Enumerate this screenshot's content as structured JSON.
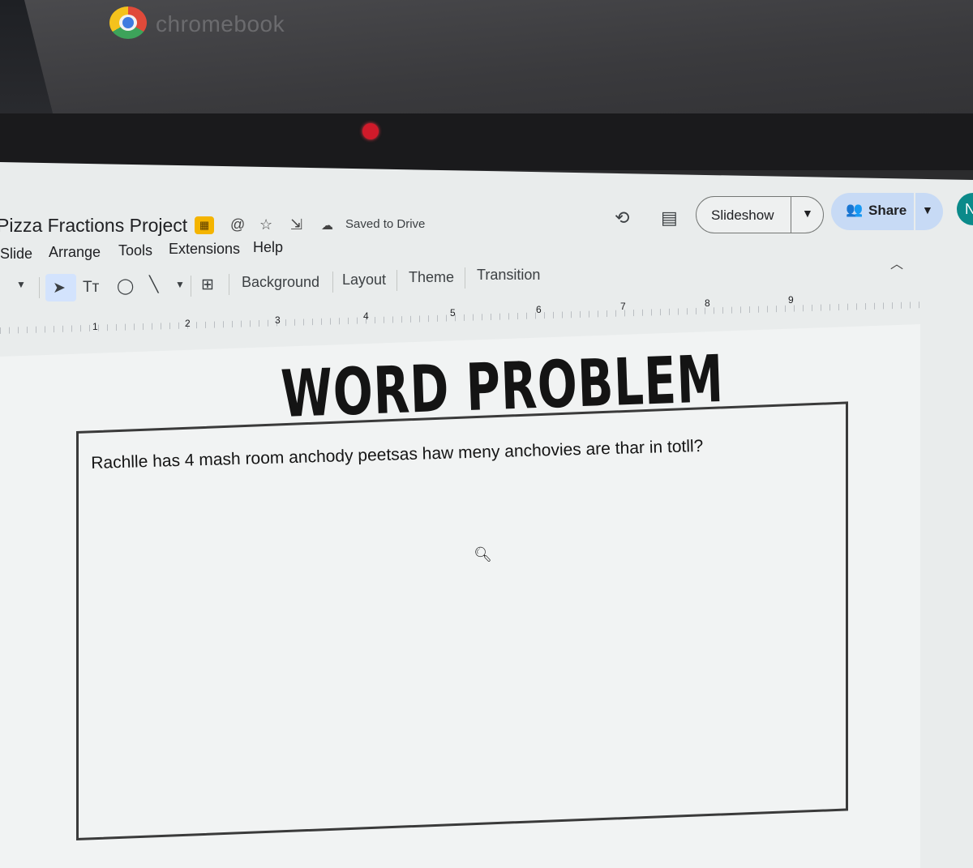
{
  "device": {
    "brand": "chromebook"
  },
  "doc": {
    "title": "Pizza Fractions Project",
    "saved_status": "Saved to Drive"
  },
  "menu": [
    "Slide",
    "Arrange",
    "Tools",
    "Extensions",
    "Help"
  ],
  "toolbar": {
    "background_label": "Background",
    "layout_label": "Layout",
    "theme_label": "Theme",
    "transition_label": "Transition"
  },
  "header_buttons": {
    "slideshow_label": "Slideshow",
    "share_label": "Share",
    "avatar_initial": "N"
  },
  "ruler": [
    "1",
    "2",
    "3",
    "4",
    "5",
    "6",
    "7",
    "8",
    "9"
  ],
  "slide": {
    "title": "WORD PROBLEM",
    "problem_text": "Rachlle has 4 mash room anchody peetsas haw meny anchovies are thar in totll?"
  }
}
